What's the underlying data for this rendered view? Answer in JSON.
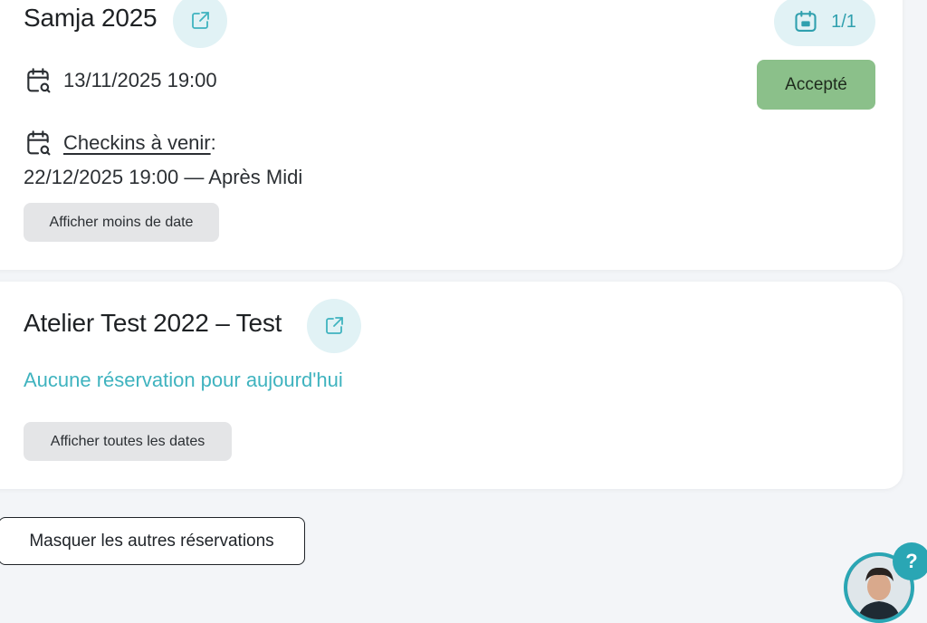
{
  "reservations": [
    {
      "title": "Samja 2025",
      "external_link_icon": "external-link-icon",
      "count": "1/1",
      "count_icon": "calendar-icon",
      "status": "Accepté",
      "status_color": "#8bc08a",
      "date": "13/11/2025 19:00",
      "date_icon": "calendar-search-icon",
      "checkins_label": "Checkins à venir",
      "checkins_separator": " :",
      "checkins_entry": "22/12/2025 19:00 — Après Midi",
      "toggle_dates_label": "Afficher moins de date"
    },
    {
      "title": "Atelier Test 2022 – Test",
      "external_link_icon": "external-link-icon",
      "empty_message": "Aucune réservation pour aujourd'hui",
      "toggle_dates_label": "Afficher toutes les dates"
    }
  ],
  "hide_others_label": "Masquer les autres réservations",
  "help": {
    "bubble_text": "?",
    "avatar_icon": "support-avatar"
  },
  "colors": {
    "accent": "#2fa0ae",
    "accent_light": "#e1f2f5",
    "status_accepted": "#8bc08a",
    "empty_text": "#3fb3bf"
  }
}
